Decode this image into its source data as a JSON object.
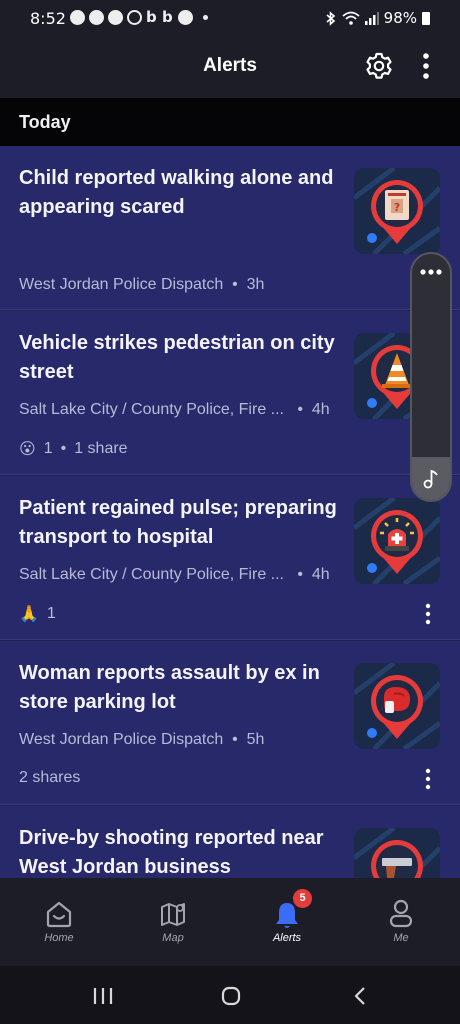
{
  "status_bar": {
    "time": "8:52",
    "battery": "98%",
    "icons": [
      "headline-icon",
      "nextdoor-icon",
      "nextdoor-icon",
      "ring-icon",
      "b-icon",
      "b-icon",
      "news-icon",
      "dot"
    ]
  },
  "header": {
    "title": "Alerts"
  },
  "section": {
    "label": "Today"
  },
  "alerts": [
    {
      "title": "Child reported walking alone and appearing scared",
      "source": "West Jordan Police Dispatch",
      "time": "3h",
      "icon": "missing-child-icon",
      "reactions": null,
      "shares": null
    },
    {
      "title": "Vehicle strikes pedestrian on city street",
      "source": "Salt Lake City / County Police, Fire ...",
      "time": "4h",
      "icon": "traffic-cone-icon",
      "reactions": {
        "emoji": "😮",
        "count": "1"
      },
      "shares": "1 share"
    },
    {
      "title": "Patient regained pulse; preparing transport to hospital",
      "source": "Salt Lake City / County Police, Fire ...",
      "time": "4h",
      "icon": "emergency-siren-icon",
      "reactions": {
        "emoji": "🙏",
        "count": "1"
      },
      "shares": null
    },
    {
      "title": "Woman reports assault by ex in store parking lot",
      "source": "West Jordan Police Dispatch",
      "time": "5h",
      "icon": "boxing-glove-icon",
      "reactions": null,
      "shares": "2 shares"
    },
    {
      "title": "Drive-by shooting reported near West Jordan business",
      "source": "",
      "time": "",
      "icon": "handgun-icon",
      "reactions": null,
      "shares": null
    }
  ],
  "bottom_nav": [
    {
      "label": "Home",
      "icon": "home-icon"
    },
    {
      "label": "Map",
      "icon": "map-icon"
    },
    {
      "label": "Alerts",
      "icon": "bell-icon",
      "badge": "5"
    },
    {
      "label": "Me",
      "icon": "person-icon"
    }
  ],
  "colors": {
    "card_bg": "#27296b",
    "accent_red": "#e53b3b",
    "accent_blue": "#2f7cf6",
    "text_secondary": "#b8bad6"
  }
}
